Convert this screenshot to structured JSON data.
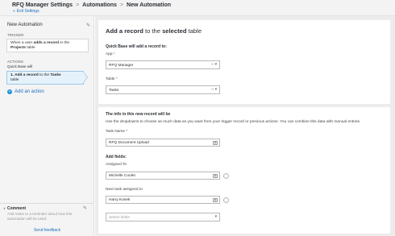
{
  "header": {
    "breadcrumb": [
      "RFQ Manager Settings",
      "Automations",
      "New Automation"
    ],
    "exit_link": "Exit Settings",
    "sep": ">"
  },
  "left": {
    "automation_name": "New Automation",
    "trigger_label": "TRIGGER",
    "trigger_text": {
      "pre": "When a user ",
      "bold1": "adds a record",
      "mid": " in the ",
      "bold2": "Projects",
      "post": " table"
    },
    "actions_label": "ACTIONS",
    "quickbase_will": "Quick Base will",
    "action_text": {
      "pre": "1. Add a record",
      "mid": " to the ",
      "bold": "Tasks",
      "post": "table"
    },
    "add_action": "Add an action",
    "comment_title": "Comment",
    "comment_placeholder": "Add notes or a reminder about how this automation will be used.",
    "send_feedback": "Send feedback"
  },
  "main": {
    "title": {
      "pre": "Add a record",
      "mid": " to the ",
      "bold": "selected",
      "post": " table"
    },
    "qb_will_add": "Quick Base will add a record to:",
    "app_label": "App",
    "app_value": "RFQ Manager",
    "table_label": "Table",
    "table_value": "Tasks",
    "info_title": "The info in this new record will be",
    "info_desc": "Use the dropdowns to choose as much data as you want from your trigger record or previous actions. You can combine this data with manual entries.",
    "task_name_label": "Task Name",
    "task_name_value": "RFQ Document Upload",
    "add_fields_label": "Add fields:",
    "assigned_to_label": "Assigned To",
    "assigned_to_value": "Michelle Coolet",
    "next_task_label": "Next task assigned to",
    "next_task_value": "Harry Kosek",
    "select_fields_placeholder": "Select fields",
    "required_mark": "*"
  },
  "colors": {
    "link": "#1a6fbf",
    "accent": "#1a8fd6",
    "selected_action_bg": "#e6f2fb"
  }
}
